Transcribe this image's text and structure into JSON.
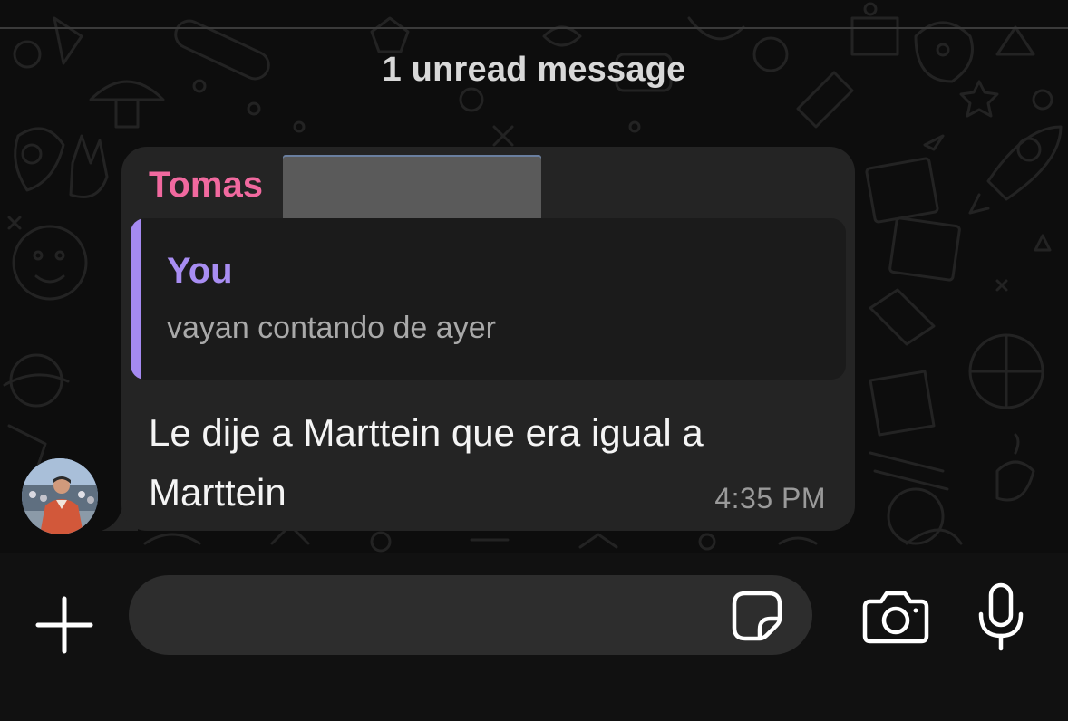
{
  "chat": {
    "unread_banner": "1 unread message"
  },
  "message": {
    "sender": "Tomas",
    "reply": {
      "author": "You",
      "text": "vayan contando de ayer"
    },
    "text": "Le dije a Marttein que era igual a Marttein",
    "time": "4:35 PM"
  },
  "composer": {
    "input_value": "",
    "input_placeholder": "",
    "icons": [
      "plus-icon",
      "sticker-icon",
      "camera-icon",
      "microphone-icon"
    ]
  },
  "colors": {
    "sender_name": "#f1699f",
    "reply_accent": "#a58af0",
    "bubble": "#242424",
    "background": "#0d0d0d"
  }
}
